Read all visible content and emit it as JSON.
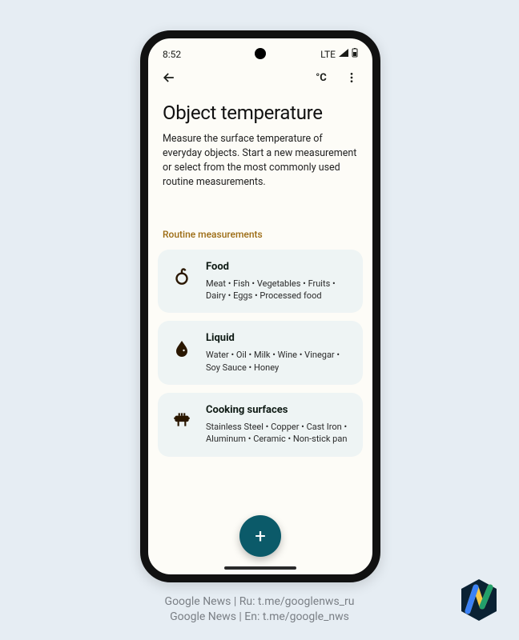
{
  "statusbar": {
    "time": "8:52",
    "net": "LTE"
  },
  "topbar": {
    "unit_label": "°C"
  },
  "page": {
    "title": "Object temperature",
    "description": "Measure the surface temperature of everyday objects. Start a new measurement or select from the most commonly used routine measurements."
  },
  "section_label": "Routine measurements",
  "cards": [
    {
      "title": "Food",
      "subtitle": "Meat • Fish • Vegetables • Fruits • Dairy • Eggs • Processed food"
    },
    {
      "title": "Liquid",
      "subtitle": "Water • Oil • Milk • Wine • Vinegar • Soy Sauce • Honey"
    },
    {
      "title": "Cooking surfaces",
      "subtitle": "Stainless Steel • Copper • Cast Iron • Aluminum • Ceramic • Non-stick pan"
    }
  ],
  "fab": {
    "glyph": "+"
  },
  "caption": {
    "line1": "Google News | Ru: t.me/googlenws_ru",
    "line2": "Google News | En: t.me/google_nws"
  }
}
